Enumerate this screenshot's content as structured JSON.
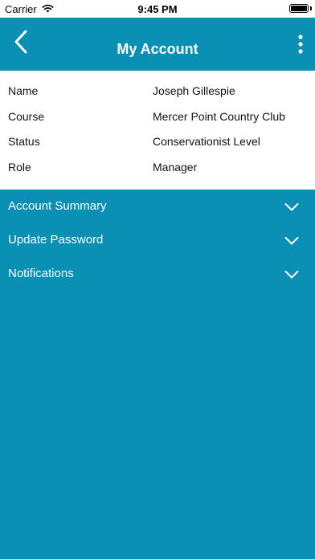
{
  "status_bar": {
    "carrier": "Carrier",
    "time": "9:45 PM",
    "wifi_icon": "wifi-icon",
    "battery_icon": "battery-icon"
  },
  "nav": {
    "title": "My Account",
    "back_icon": "chevron-left-icon",
    "more_icon": "more-vertical-icon"
  },
  "account_info": {
    "rows": [
      {
        "label": "Name",
        "value": "Joseph Gillespie"
      },
      {
        "label": "Course",
        "value": "Mercer Point Country Club"
      },
      {
        "label": "Status",
        "value": "Conservationist Level"
      },
      {
        "label": "Role",
        "value": "Manager"
      }
    ]
  },
  "sections": [
    {
      "label": "Account Summary",
      "icon": "chevron-down-icon"
    },
    {
      "label": "Update Password",
      "icon": "chevron-down-icon"
    },
    {
      "label": "Notifications",
      "icon": "chevron-down-icon"
    }
  ],
  "colors": {
    "primary": "#0a8fb5",
    "card": "#ffffff",
    "text_light": "#ffffff",
    "text_dark": "#111111"
  }
}
